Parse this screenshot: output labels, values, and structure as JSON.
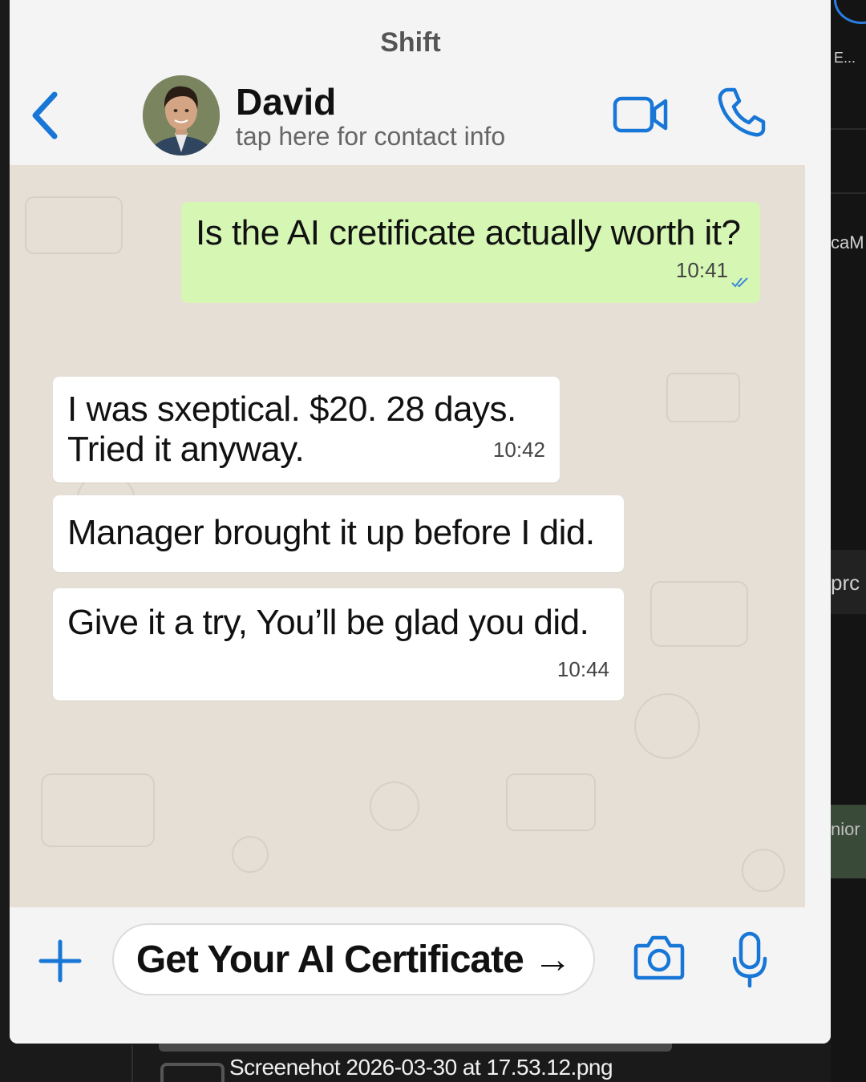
{
  "background": {
    "side_texts": [
      "E...",
      "caM",
      "prc",
      "nior"
    ],
    "filename": "Screenehot 2026-03-30 at 17.53.12.png"
  },
  "header": {
    "app_title": "Shift",
    "contact_name": "David",
    "contact_subtitle": "tap here for contact info",
    "icons": [
      "back-chevron-icon",
      "video-call-icon",
      "phone-call-icon"
    ]
  },
  "messages": [
    {
      "direction": "outgoing",
      "text": "Is the AI cretificate actually worth it?",
      "time": "10:41",
      "status": "read"
    },
    {
      "direction": "incoming",
      "text": "I was sxeptical. $20. 28 days. Tried it anyway.",
      "time": "10:42"
    },
    {
      "direction": "incoming",
      "text": "Manager brought it up before I did.",
      "time": ""
    },
    {
      "direction": "incoming",
      "text": "Give it a try, You’ll be glad you did.",
      "time": "10:44"
    }
  ],
  "composer": {
    "cta_label": "Get Your AI Certificate →",
    "icons": [
      "plus-icon",
      "camera-icon",
      "microphone-icon"
    ]
  },
  "colors": {
    "accent": "#1877d6",
    "outgoing_bubble": "#d6f7b4",
    "incoming_bubble": "#ffffff",
    "chat_background": "#e5dfd5"
  }
}
